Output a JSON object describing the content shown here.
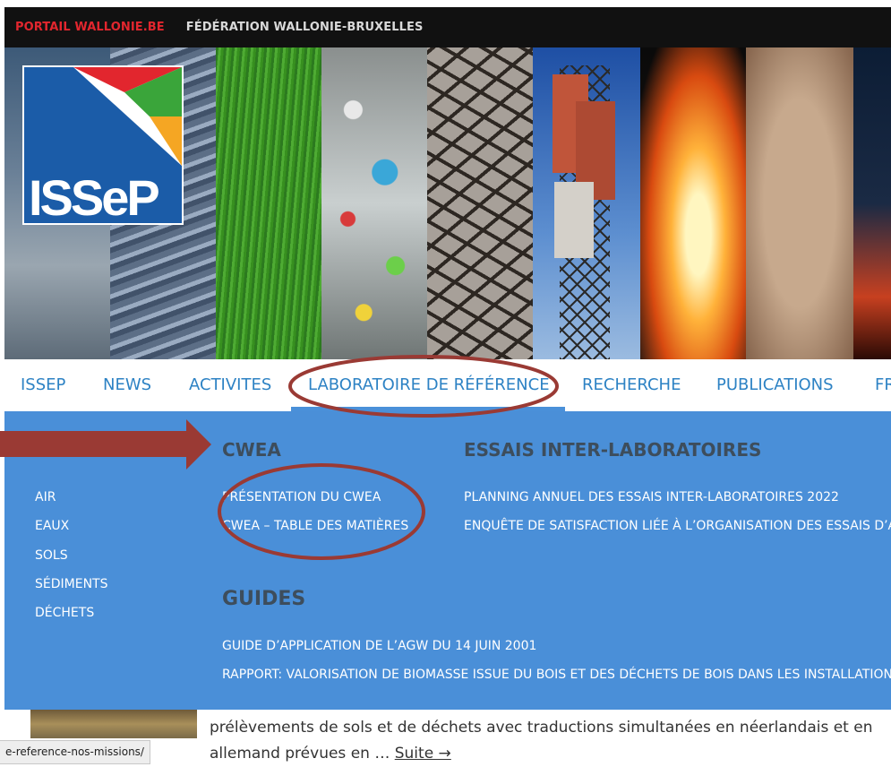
{
  "topbar": {
    "links": [
      "PORTAIL WALLONIE.BE",
      "FÉDÉRATION WALLONIE-BRUXELLES"
    ]
  },
  "logo": {
    "text": "ISSeP"
  },
  "nav": {
    "items": [
      "ISSeP",
      "NEWS",
      "ACTIVITES",
      "LABORATOIRE DE RÉFÉRENCE",
      "RECHERCHE",
      "PUBLICATIONS",
      "FR"
    ],
    "active": "LABORATOIRE DE RÉFÉRENCE"
  },
  "mega": {
    "left_links": [
      "AIR",
      "EAUX",
      "SOLS",
      "SÉDIMENTS",
      "DÉCHETS"
    ],
    "cwea": {
      "heading": "CWEA",
      "links": [
        "PRÉSENTATION DU CWEA",
        "CWEA – TABLE DES MATIÈRES"
      ]
    },
    "essais": {
      "heading": "ESSAIS INTER-LABORATOIRES",
      "links": [
        "PLANNING ANNUEL DES ESSAIS INTER-LABORATOIRES 2022",
        "ENQUÊTE DE SATISFACTION LIÉE À L’ORGANISATION DES ESSAIS D’AP"
      ]
    },
    "guides": {
      "heading": "GUIDES",
      "links": [
        "GUIDE D’APPLICATION DE L’AGW DU 14 JUIN 2001",
        "RAPPORT: VALORISATION DE BIOMASSE ISSUE DU BOIS ET DES DÉCHETS DE BOIS DANS LES INSTALLATIONS"
      ]
    }
  },
  "content": {
    "line1": "prélèvements de sols et de déchets avec traductions simultanées en néerlandais et en",
    "line2": "allemand prévues en … ",
    "more": "Suite →"
  },
  "status_url": "e-reference-nos-missions/",
  "colors": {
    "topbar_bg": "#111111",
    "portal_link": "#e2262e",
    "nav_text": "#2d82c4",
    "menu_bg": "#4a8fd8",
    "menu_heading": "#3d4d5c",
    "annotation": "#9a3a34"
  }
}
